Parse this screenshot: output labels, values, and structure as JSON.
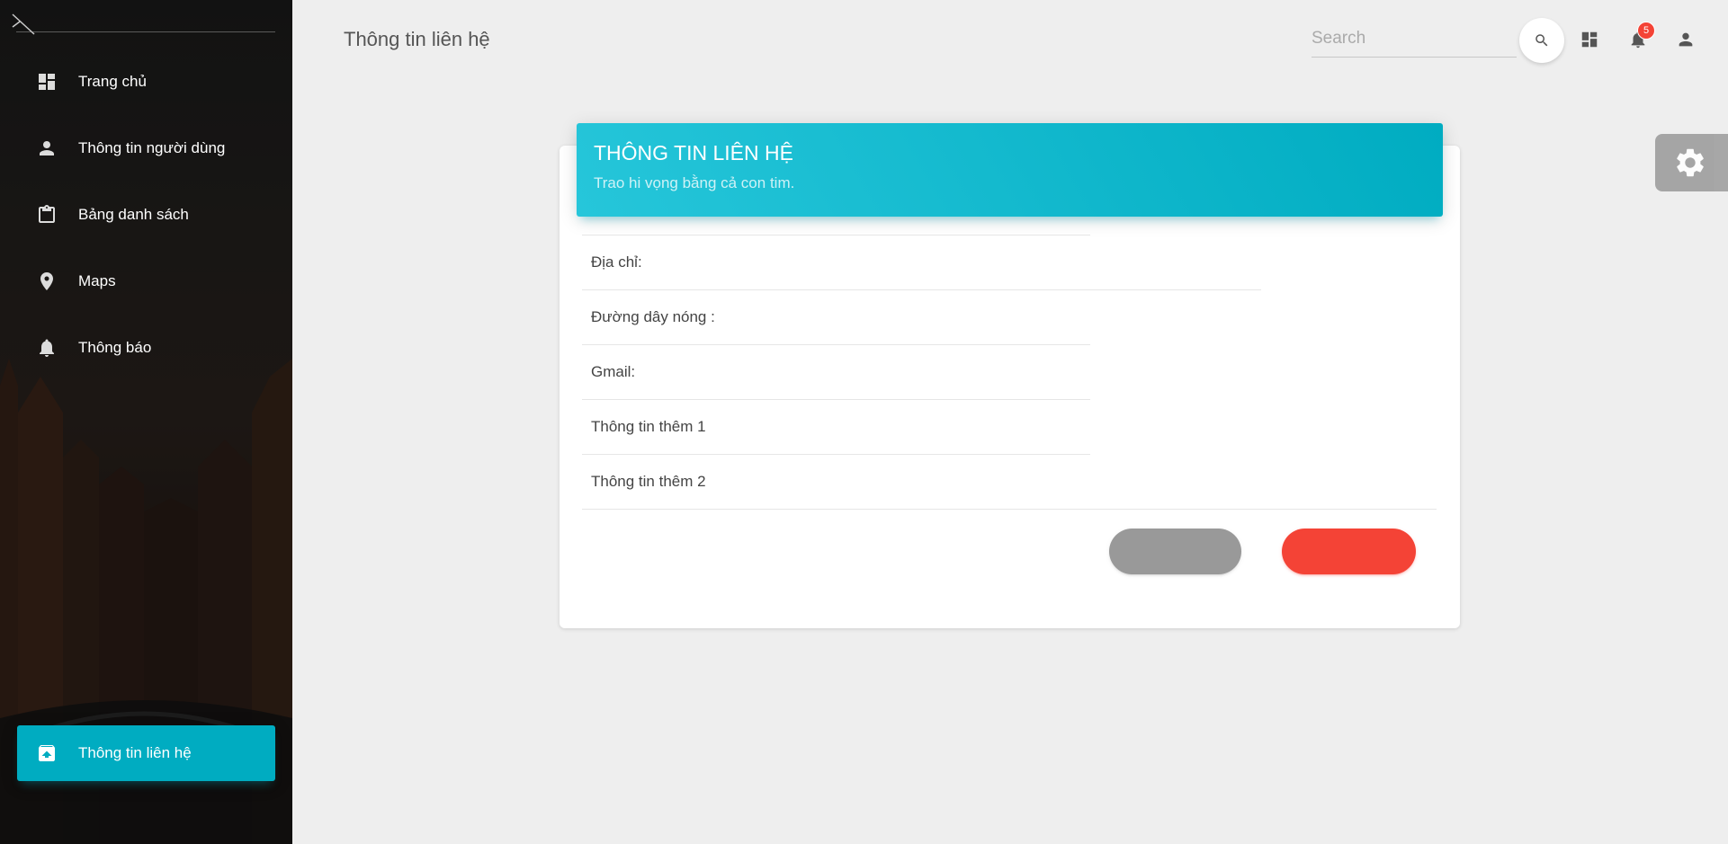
{
  "sidebar": {
    "items": [
      {
        "label": "Trang chủ",
        "icon": "dashboard-icon"
      },
      {
        "label": "Thông tin người dùng",
        "icon": "person-icon"
      },
      {
        "label": "Bảng danh sách",
        "icon": "clipboard-icon"
      },
      {
        "label": "Maps",
        "icon": "location-pin-icon"
      },
      {
        "label": "Thông báo",
        "icon": "notifications-icon"
      }
    ],
    "active_item": {
      "label": "Thông tin liên hệ",
      "icon": "unarchive-icon"
    }
  },
  "header": {
    "title": "Thông tin liên hệ",
    "search": {
      "placeholder": "Search",
      "value": ""
    },
    "notification_count": "5"
  },
  "card": {
    "title": "THÔNG TIN LIÊN HỆ",
    "subtitle": "Trao hi vọng bằng cả con tim.",
    "rows": [
      {
        "label": "Địa chỉ:"
      },
      {
        "label": "Đường dây nóng :"
      },
      {
        "label": "Gmail:"
      },
      {
        "label": "Thông tin thêm 1"
      },
      {
        "label": "Thông tin thêm 2"
      }
    ],
    "buttons": {
      "secondary_label": "",
      "primary_label": ""
    }
  },
  "colors": {
    "accent": "#00acc1",
    "header_gradient_start": "#26c6da",
    "primary_button": "#f44336",
    "secondary_button": "#999999",
    "badge": "#f44336",
    "background": "#eeeeee"
  }
}
